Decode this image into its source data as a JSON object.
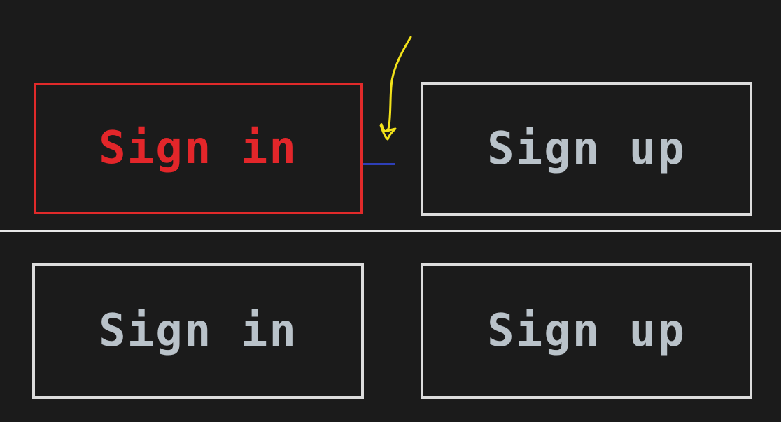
{
  "panels": {
    "top": {
      "state": "focused",
      "sign_in_label": "Sign in",
      "sign_up_label": "Sign up"
    },
    "bottom": {
      "state": "default",
      "sign_in_label": "Sign in",
      "sign_up_label": "Sign up"
    }
  },
  "colors": {
    "background": "#1b1b1b",
    "active_accent": "#e12a2a",
    "default_border": "#dcdcdc",
    "default_text": "#b9c2c9",
    "connector": "#2e3fb8",
    "annotation": "#f2e21a",
    "divider": "#e8e8e8"
  },
  "annotation": {
    "icon": "arrow-annotation-icon"
  }
}
